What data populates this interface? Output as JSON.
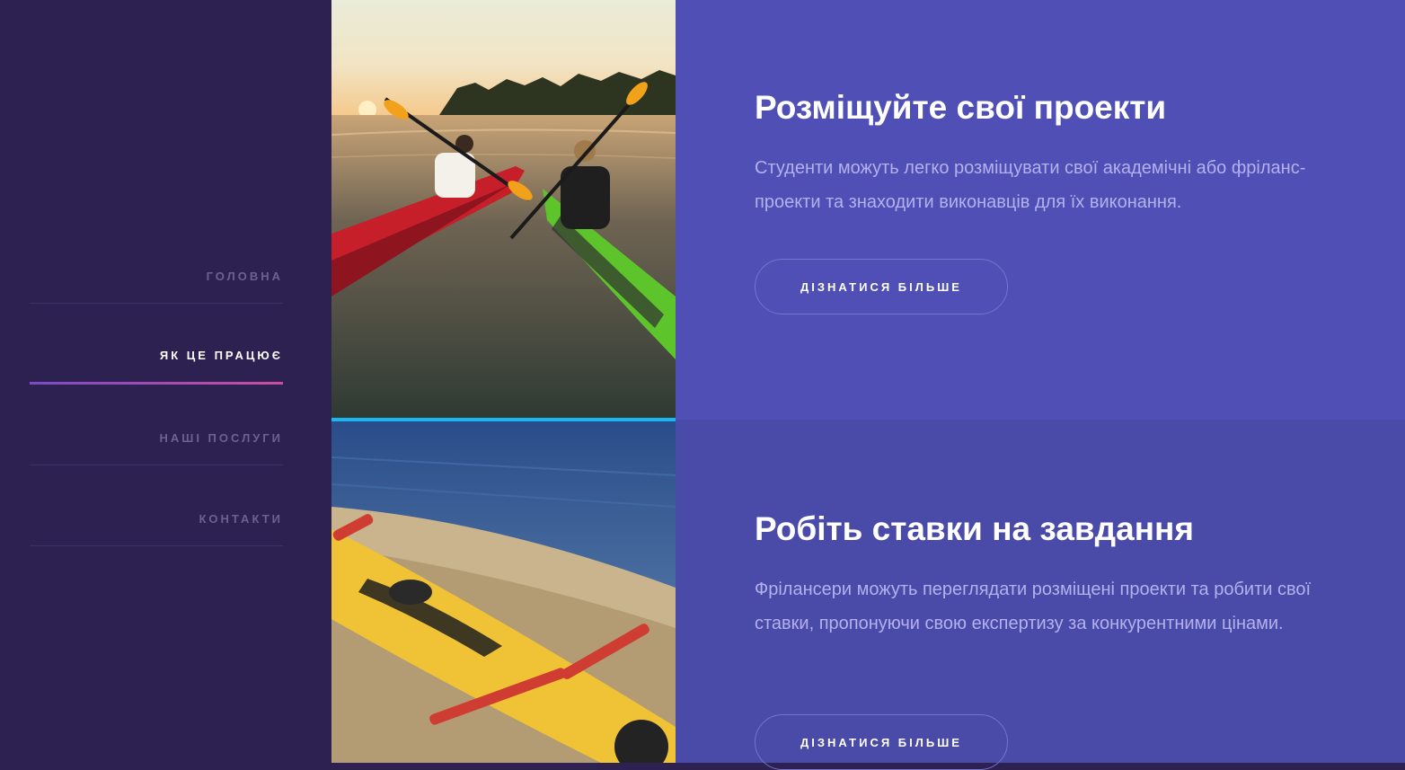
{
  "nav": {
    "items": [
      {
        "label": "ГОЛОВНА",
        "active": false
      },
      {
        "label": "ЯК ЦЕ ПРАЦЮЄ",
        "active": true
      },
      {
        "label": "НАШІ ПОСЛУГИ",
        "active": false
      },
      {
        "label": "КОНТАКТИ",
        "active": false
      }
    ]
  },
  "sections": [
    {
      "title": "Розміщуйте свої проекти",
      "text": "Студенти можуть легко розміщувати свої академічні або фріланс-проекти та знаходити виконавців для їх виконання.",
      "button": "ДІЗНАТИСЯ БІЛЬШЕ"
    },
    {
      "title": "Робіть ставки на завдання",
      "text": "Фрілансери можуть переглядати розміщені проекти та робити свої ставки, пропонуючи свою експертизу за конкурентними цінами.",
      "button": "ДІЗНАТИСЯ БІЛЬШЕ"
    }
  ],
  "colors": {
    "sidebar": "#2c2150",
    "panel_top": "#4f4fb5",
    "panel_bottom": "#4a4aa9",
    "accent_line": "#19b8f2"
  }
}
